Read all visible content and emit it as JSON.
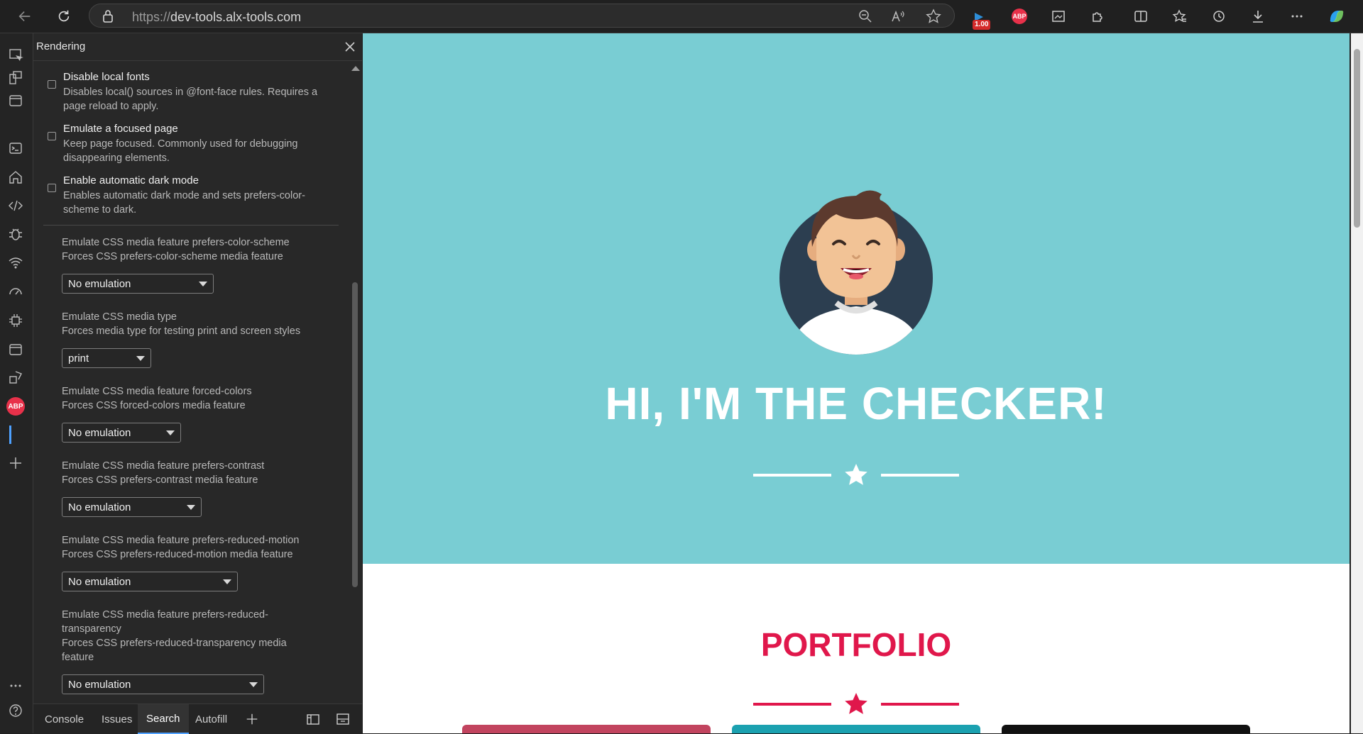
{
  "browser": {
    "url_prefix": "https://",
    "url_host": "dev-tools.alx-tools.com",
    "extension_badge": "1.00",
    "abp_label": "ABP"
  },
  "devtools": {
    "panel_title": "Rendering",
    "abp_label": "ABP",
    "checkbox_options": [
      {
        "title": "Disable local fonts",
        "desc": "Disables local() sources in @font-face rules. Requires a page reload to apply.",
        "checked": false
      },
      {
        "title": "Emulate a focused page",
        "desc": "Keep page focused. Commonly used for debugging disappearing elements.",
        "checked": false
      },
      {
        "title": "Enable automatic dark mode",
        "desc": "Enables automatic dark mode and sets prefers-color-scheme to dark.",
        "checked": false
      }
    ],
    "emulations": [
      {
        "title": "Emulate CSS media feature prefers-color-scheme",
        "desc": "Forces CSS prefers-color-scheme media feature",
        "value": "No emulation"
      },
      {
        "title": "Emulate CSS media type",
        "desc": "Forces media type for testing print and screen styles",
        "value": "print"
      },
      {
        "title": "Emulate CSS media feature forced-colors",
        "desc": "Forces CSS forced-colors media feature",
        "value": "No emulation"
      },
      {
        "title": "Emulate CSS media feature prefers-contrast",
        "desc": "Forces CSS prefers-contrast media feature",
        "value": "No emulation"
      },
      {
        "title": "Emulate CSS media feature prefers-reduced-motion",
        "desc": "Forces CSS prefers-reduced-motion media feature",
        "value": "No emulation"
      },
      {
        "title": "Emulate CSS media feature prefers-reduced-transparency",
        "desc": "Forces CSS prefers-reduced-transparency media feature",
        "value": "No emulation"
      }
    ],
    "drawer_tabs": [
      "Console",
      "Issues",
      "Search",
      "Autofill"
    ],
    "active_tab": "Search"
  },
  "page": {
    "hero_title": "HI, I'M THE CHECKER!",
    "section_title": "PORTFOLIO",
    "colors": {
      "hero_bg": "#79cdd3",
      "accent": "#e0174b",
      "avatar_bg": "#2c3e50",
      "card_1": "#c2445f",
      "card_2": "#1ba1b0",
      "card_3": "#111111"
    }
  }
}
